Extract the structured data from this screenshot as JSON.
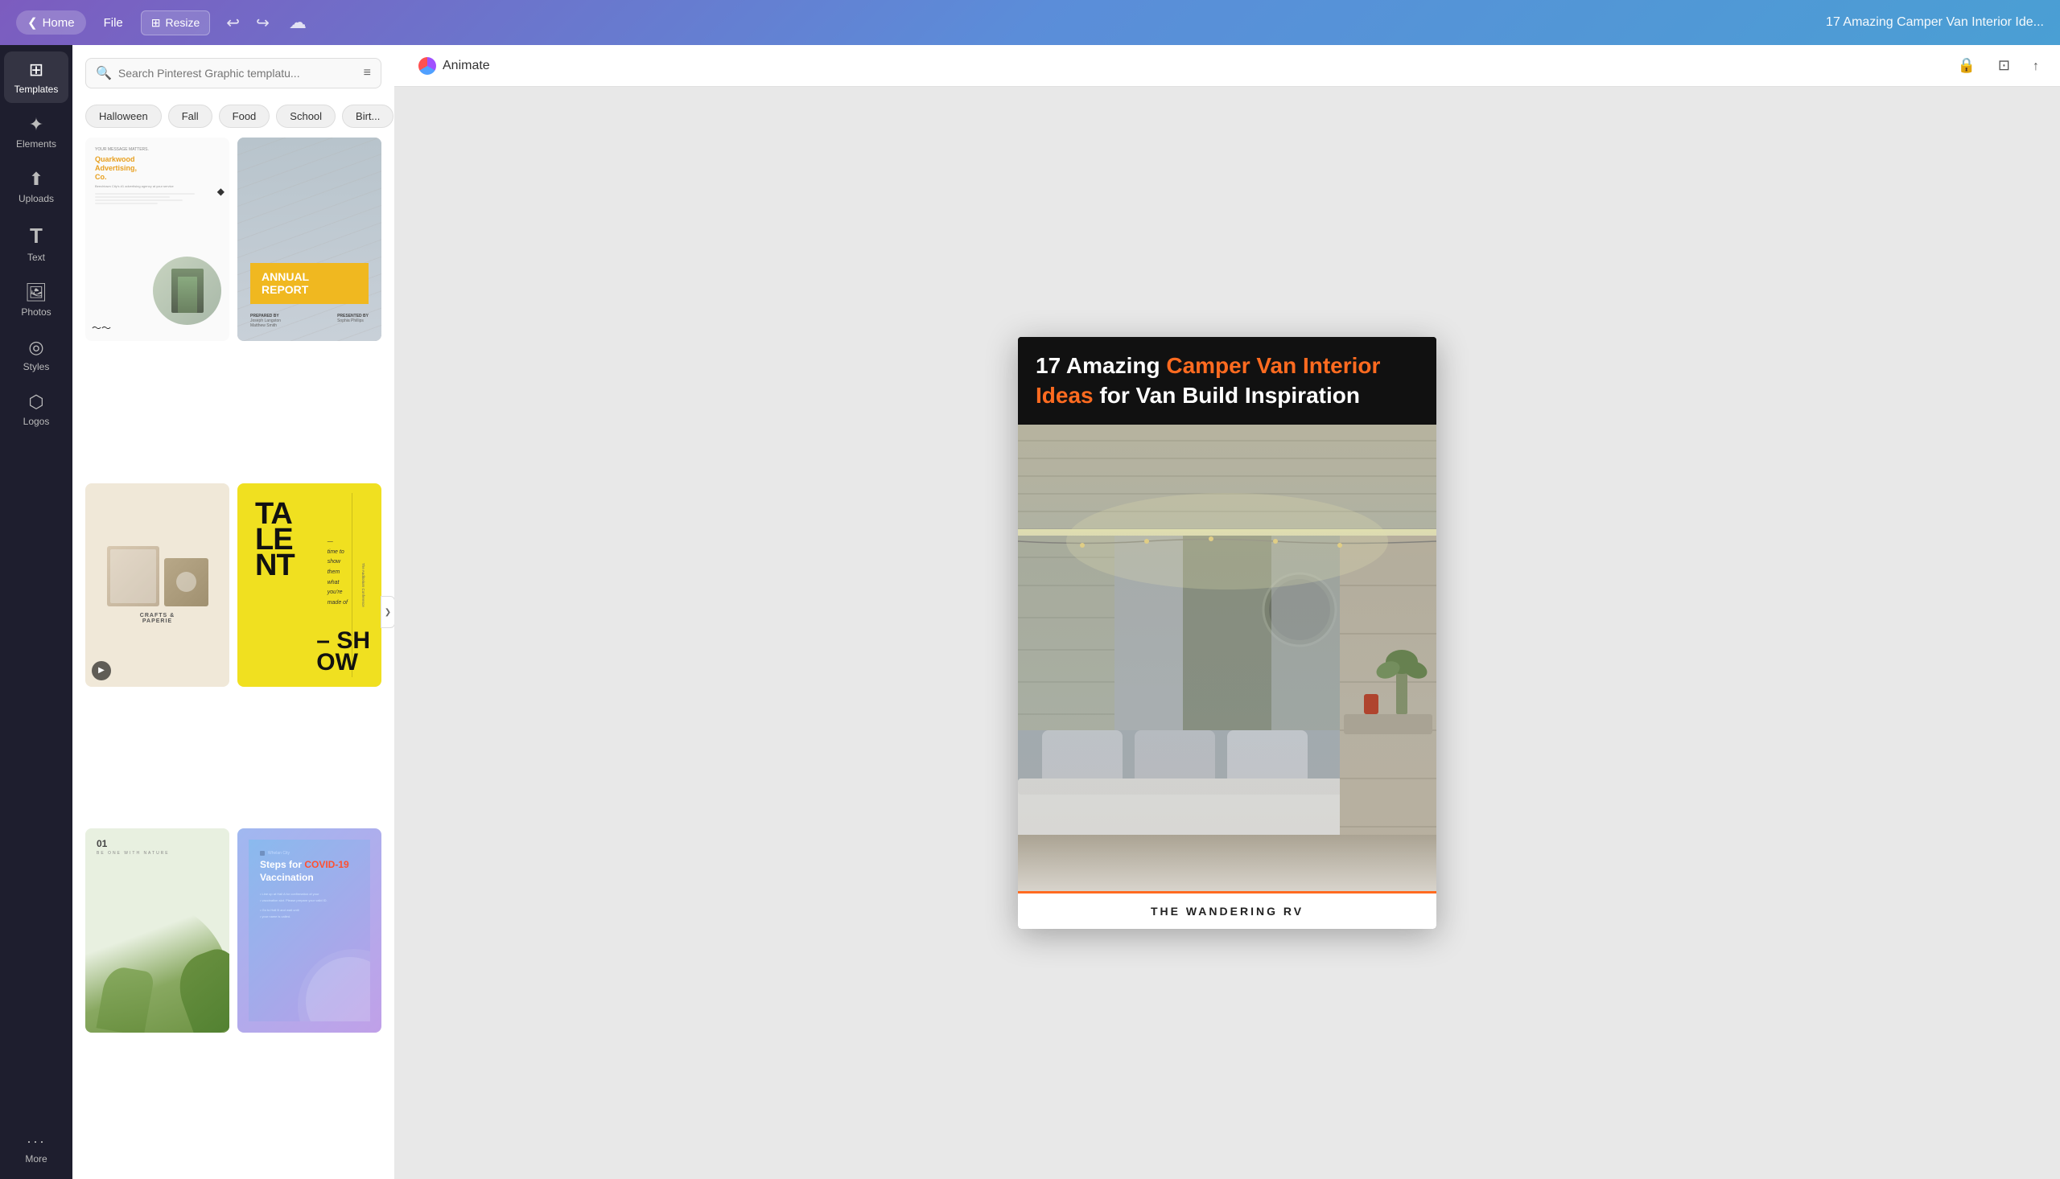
{
  "topbar": {
    "back_label": "Home",
    "file_label": "File",
    "resize_label": "Resize",
    "undo_icon": "↩",
    "redo_icon": "↪",
    "cloud_icon": "☁",
    "title": "17 Amazing Camper Van Interior Ide..."
  },
  "sidebar": {
    "items": [
      {
        "id": "templates",
        "label": "Templates",
        "icon": "⊞"
      },
      {
        "id": "elements",
        "label": "Elements",
        "icon": "✦"
      },
      {
        "id": "uploads",
        "label": "Uploads",
        "icon": "↑"
      },
      {
        "id": "text",
        "label": "Text",
        "icon": "T"
      },
      {
        "id": "photos",
        "label": "Photos",
        "icon": "🖼"
      },
      {
        "id": "styles",
        "label": "Styles",
        "icon": "◎"
      },
      {
        "id": "logos",
        "label": "Logos",
        "icon": "⬡"
      },
      {
        "id": "more",
        "label": "More",
        "icon": "···"
      }
    ]
  },
  "panel": {
    "search_placeholder": "Search Pinterest Graphic templatu...",
    "filter_chips": [
      {
        "id": "halloween",
        "label": "Halloween"
      },
      {
        "id": "fall",
        "label": "Fall"
      },
      {
        "id": "food",
        "label": "Food"
      },
      {
        "id": "school",
        "label": "School"
      },
      {
        "id": "birthday",
        "label": "Birt..."
      }
    ]
  },
  "templates": [
    {
      "id": "tmpl1",
      "type": "quarkwood",
      "brand": "Quarkwood Advertising, Co.",
      "tagline": "YOUR MESSAGE MATTERS."
    },
    {
      "id": "tmpl2",
      "type": "annual-report",
      "title": "ANNUAL REPORT",
      "prepared_by": "PREPARED BY",
      "presented_by": "PRESENTED BY"
    },
    {
      "id": "tmpl3",
      "type": "crafts",
      "label": "CRAFTS & PAPERIE",
      "has_video": true
    },
    {
      "id": "tmpl4",
      "type": "talent",
      "big_text": "TA LE NT",
      "show_text": "SH OW",
      "italic_text": "time to show them what you're made of"
    },
    {
      "id": "tmpl5",
      "type": "nature",
      "number": "01",
      "label": "BE ONE WITH NATURE"
    },
    {
      "id": "tmpl6",
      "type": "covid",
      "org": "Whelan City",
      "title": "Steps for",
      "highlight": "COVID-19",
      "subtitle": "Vaccination"
    }
  ],
  "canvas": {
    "animate_label": "Animate",
    "design_title_normal": "17 Amazing ",
    "design_title_highlight": "Camper Van Interior Ideas",
    "design_title_suffix": " for Van Build Inspiration",
    "brand_footer": "THE WANDERING RV"
  },
  "icons": {
    "search": "🔍",
    "filter": "⚙",
    "lock": "🔒",
    "copy": "⊡",
    "share": "↑",
    "chevron_right": "❯",
    "play": "▶"
  }
}
